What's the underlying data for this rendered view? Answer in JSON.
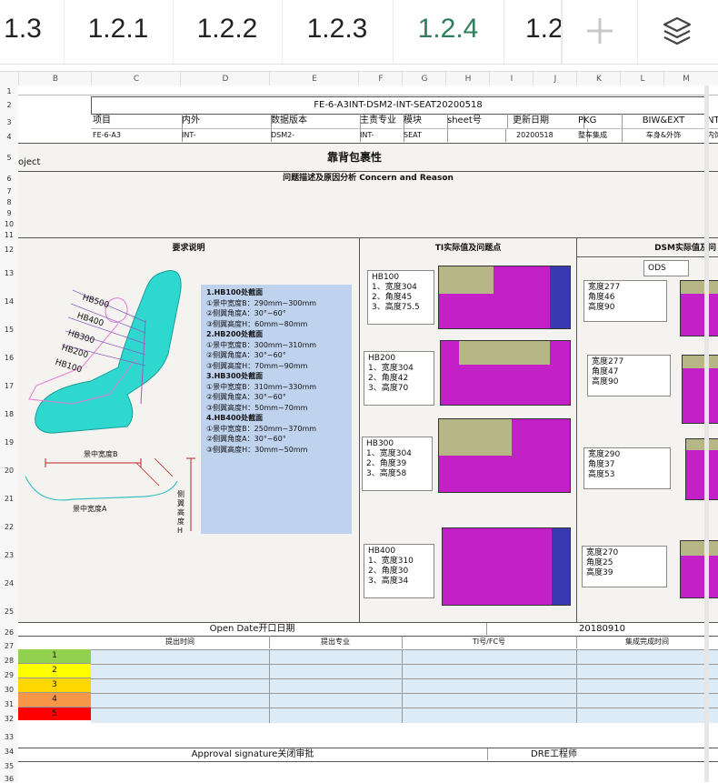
{
  "tabs": [
    {
      "label": "1.3"
    },
    {
      "label": "1.2.1"
    },
    {
      "label": "1.2.2"
    },
    {
      "label": "1.2.3"
    },
    {
      "label": "1.2.4"
    },
    {
      "label": "1.2"
    }
  ],
  "tab_add_icon": "plus-icon",
  "tab_layers_icon": "layers-icon",
  "columns": [
    "B",
    "C",
    "D",
    "E",
    "F",
    "G",
    "H",
    "I",
    "J",
    "K",
    "L",
    "M"
  ],
  "rows": [
    "1",
    "2",
    "3",
    "4",
    "5",
    "6",
    "7",
    "8",
    "9",
    "10",
    "11",
    "12",
    "13",
    "14",
    "15",
    "16",
    "17",
    "18",
    "19",
    "20",
    "21",
    "22",
    "23",
    "24",
    "25",
    "26",
    "27",
    "28",
    "29",
    "30",
    "31",
    "32",
    "33",
    "34",
    "35",
    "36"
  ],
  "doc": {
    "code": "FE-6-A3INT-DSM2-INT-SEAT20200518",
    "headers": [
      "项目",
      "内外",
      "数据版本",
      "主责专业",
      "模块",
      "sheet号",
      "更新日期",
      "PKG",
      "BIW&EXT",
      "NT"
    ],
    "values": [
      "FE-6-A3",
      "INT-",
      "DSM2-",
      "INT-",
      "SEAT",
      "",
      "20200518",
      "整车集成",
      "车身&外饰",
      "内饰"
    ],
    "project_label": "oject",
    "title": "靠背包裹性",
    "section_title": "问题描述及原因分析 Concern and Reason",
    "col_req": "要求说明",
    "col_ti": "TI实际值及问题点",
    "col_dsm": "DSM实际值及问",
    "ods_label": "ODS"
  },
  "seat_labels": [
    "HB500",
    "HB400",
    "HB300",
    "HB200",
    "HB100"
  ],
  "dim_labels": {
    "width": "景中宽度B",
    "angle": "景中宽度A",
    "height": "侧翼高度H"
  },
  "requirements": [
    "1.HB100处截面",
    "①景中宽度B：290mm~300mm",
    "②侧翼角度A：30°~60°",
    "③侧翼高度H：60mm~80mm",
    "2.HB200处截面",
    "①景中宽度B：300mm~310mm",
    "②侧翼角度A：30°~60°",
    "③侧翼高度H：70mm~90mm",
    "3.HB300处截面",
    "①景中宽度B：310mm~330mm",
    "②侧翼角度A：30°~60°",
    "③侧翼高度H：50mm~70mm",
    "4.HB400处截面",
    "①景中宽度B：250mm~370mm",
    "②侧翼角度A：30°~60°",
    "③侧翼高度H：30mm~50mm"
  ],
  "ti_boxes": [
    {
      "title": "HB100",
      "lines": "1、宽度304\n2、角度45\n3、高度75.5"
    },
    {
      "title": "HB200",
      "lines": "1、宽度304\n2、角度42\n3、高度70"
    },
    {
      "title": "HB300",
      "lines": "1、宽度304\n2、角度39\n3、高度58"
    },
    {
      "title": "HB400",
      "lines": "1、宽度310\n2、角度30\n3、高度34"
    }
  ],
  "dsm_boxes": [
    {
      "lines": "宽度277\n角度46\n高度90"
    },
    {
      "lines": "宽度277\n角度47\n高度90"
    },
    {
      "lines": "宽度290\n角度37\n高度53"
    },
    {
      "lines": "宽度270\n角度25\n高度39"
    }
  ],
  "open_date": {
    "label": "Open Date开口日期",
    "value": "20180910"
  },
  "table": {
    "headers": [
      "提出时间",
      "提出专业",
      "TI号/FC号",
      "集成完成时间"
    ],
    "levels": [
      {
        "label": "1",
        "color": "#92d050"
      },
      {
        "label": "2",
        "color": "#ffff00"
      },
      {
        "label": "3",
        "color": "#ffd700"
      },
      {
        "label": "4",
        "color": "#f79646"
      },
      {
        "label": "5",
        "color": "#ff0000"
      }
    ],
    "fill_color": "#ddebf7"
  },
  "approval": {
    "label": "Approval signature关闭审批",
    "engineer": "DRE工程师"
  }
}
